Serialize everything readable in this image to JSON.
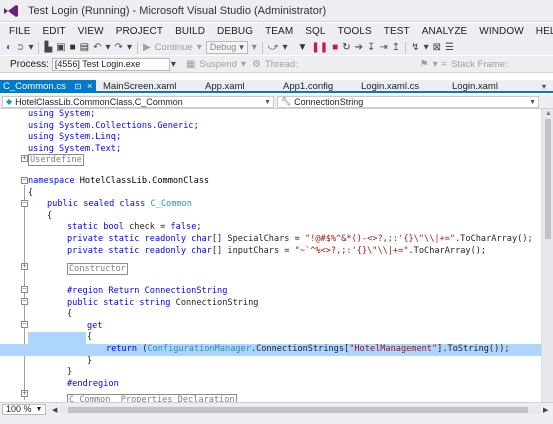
{
  "window": {
    "title": "Test Login (Running) - Microsoft Visual Studio (Administrator)"
  },
  "menu": [
    "FILE",
    "EDIT",
    "VIEW",
    "PROJECT",
    "BUILD",
    "DEBUG",
    "TEAM",
    "SQL",
    "TOOLS",
    "TEST",
    "ANALYZE",
    "WINDOW",
    "HELP"
  ],
  "toolbar": {
    "continue_label": "Continue",
    "config_value": "Debug",
    "process_label": "Process:",
    "process_value": "[4556] Test Login.exe",
    "suspend_label": "Suspend",
    "thread_label": "Thread:",
    "stack_frame_label": "Stack Frame:"
  },
  "tabs": [
    {
      "label": "C_Common.cs",
      "active": true,
      "pin": "⊡",
      "close": "×"
    },
    {
      "label": "MainScreen.xaml",
      "active": false
    },
    {
      "label": "App.xaml",
      "active": false
    },
    {
      "label": "App1.config",
      "active": false
    },
    {
      "label": "Login.xaml.cs",
      "active": false
    },
    {
      "label": "Login.xaml",
      "active": false
    }
  ],
  "navbar": {
    "type_scope": "HotelClassLib.CommonClass.C_Common",
    "member_scope": "ConnectionString"
  },
  "code": {
    "using1": "using System;",
    "using2": "using System.Collections.Generic;",
    "using3": "using System.Linq;",
    "using4": "using System.Text;",
    "userdefine": "Userdefine",
    "namespace_kw": "namespace",
    "namespace_name": " HotelClassLib.CommonClass",
    "brace_open": "{",
    "brace_close": "}",
    "class_kw": "public sealed class",
    "class_name": "C_Common",
    "check_line_kw": "static bool",
    "check_line_rest": " check = ",
    "false_kw": "false",
    "semicolon": ";",
    "sc_kw": "private static readonly char",
    "sc_rest": "[] SpecialChars = ",
    "sc_str": "\"!@#$%^&*()-<>?,;:'{}\\\"\\\\|+=\"",
    "sc_tail": ".ToCharArray();",
    "ic_kw": "private static readonly char",
    "ic_rest": "[] inputChars = ",
    "ic_str": "\"~`^%<>?,;:'{}\\\"\\\\|+=\"",
    "ic_tail": ".ToCharArray();",
    "constructor": "Constructor",
    "region_line": "#region Return ConnectionString",
    "prop_kw": "public static string",
    "prop_name": " ConnectionString",
    "get_kw": "get",
    "return_kw": "return",
    "cm_type": "ConfigurationManager",
    "cm_mid": ".ConnectionStrings[",
    "cm_key": "\"HotelManagement\"",
    "cm_tail": "].ToString());",
    "return_open": " (",
    "endregion": "#endregion",
    "property_decl": "C_Common  Properties Declaration"
  },
  "status": {
    "zoom": "100 %"
  },
  "colors": {
    "accent": "#007acc",
    "selection": "#add6ff",
    "keyword": "#0000ff",
    "type": "#2b91af",
    "string": "#a31515"
  }
}
